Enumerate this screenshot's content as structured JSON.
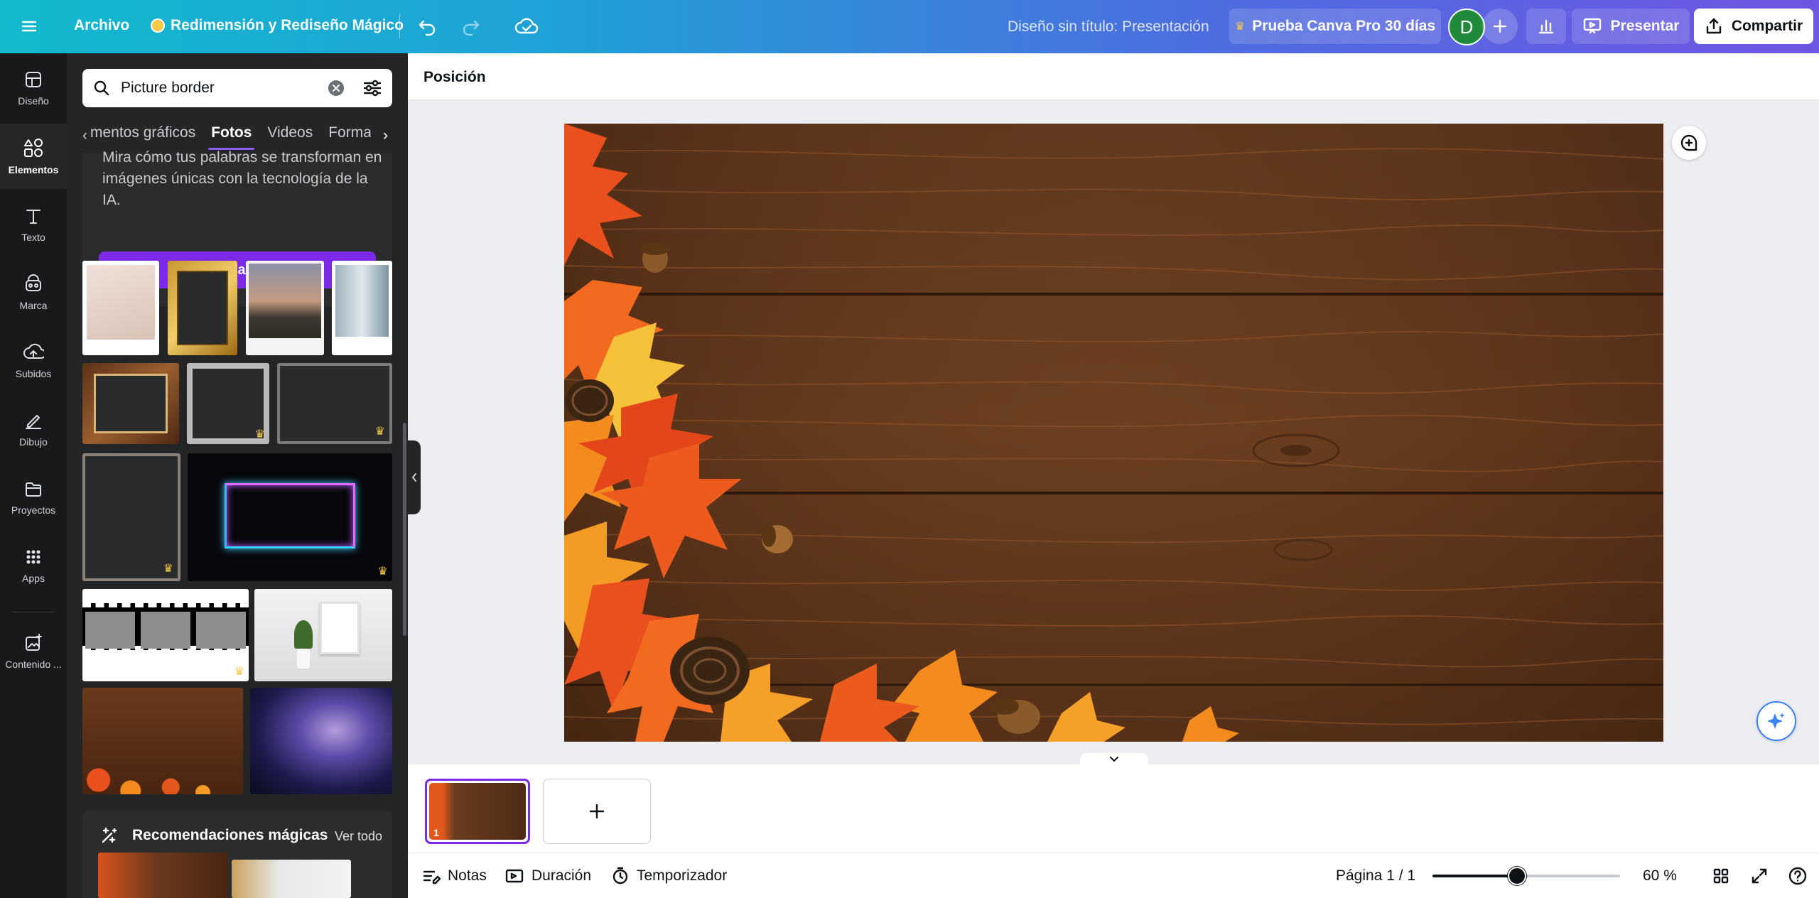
{
  "topbar": {
    "menu_label": "Archivo",
    "magic_resize_label": "Redimensión y Rediseño Mágico",
    "document_title": "Diseño sin título: Presentación",
    "pro_trial_label": "Prueba Canva Pro 30 días",
    "avatar_initial": "D",
    "present_label": "Presentar",
    "share_label": "Compartir"
  },
  "rail": {
    "items": [
      {
        "label": "Diseño",
        "icon": "layout-icon"
      },
      {
        "label": "Elementos",
        "icon": "shapes-icon"
      },
      {
        "label": "Texto",
        "icon": "text-icon"
      },
      {
        "label": "Marca",
        "icon": "brand-icon"
      },
      {
        "label": "Subidos",
        "icon": "upload-icon"
      },
      {
        "label": "Dibujo",
        "icon": "draw-icon"
      },
      {
        "label": "Proyectos",
        "icon": "folder-icon"
      },
      {
        "label": "Apps",
        "icon": "apps-icon"
      },
      {
        "label": "Contenido ...",
        "icon": "magic-media-icon"
      }
    ],
    "active": "Elementos"
  },
  "panel": {
    "search_value": "Picture border",
    "tabs": [
      "mentos gráficos",
      "Fotos",
      "Videos",
      "Formas"
    ],
    "active_tab": "Fotos",
    "promo_text": "Mira cómo tus palabras se transforman en imágenes únicas con la tecnología de la IA.",
    "generate_button": "Generar la imagen",
    "magic_section_title": "Recomendaciones mágicas",
    "see_all": "Ver todo"
  },
  "context_bar": {
    "position_label": "Posición"
  },
  "pages": {
    "current_page_number": "1"
  },
  "bottombar": {
    "notes_label": "Notas",
    "duration_label": "Duración",
    "timer_label": "Temporizador",
    "page_indicator": "Página 1 / 1",
    "zoom_level": "60 %",
    "zoom_fraction": 0.45
  },
  "colors": {
    "accent": "#7d2ae8",
    "panel_bg": "#242526",
    "rail_bg": "#18191b"
  }
}
